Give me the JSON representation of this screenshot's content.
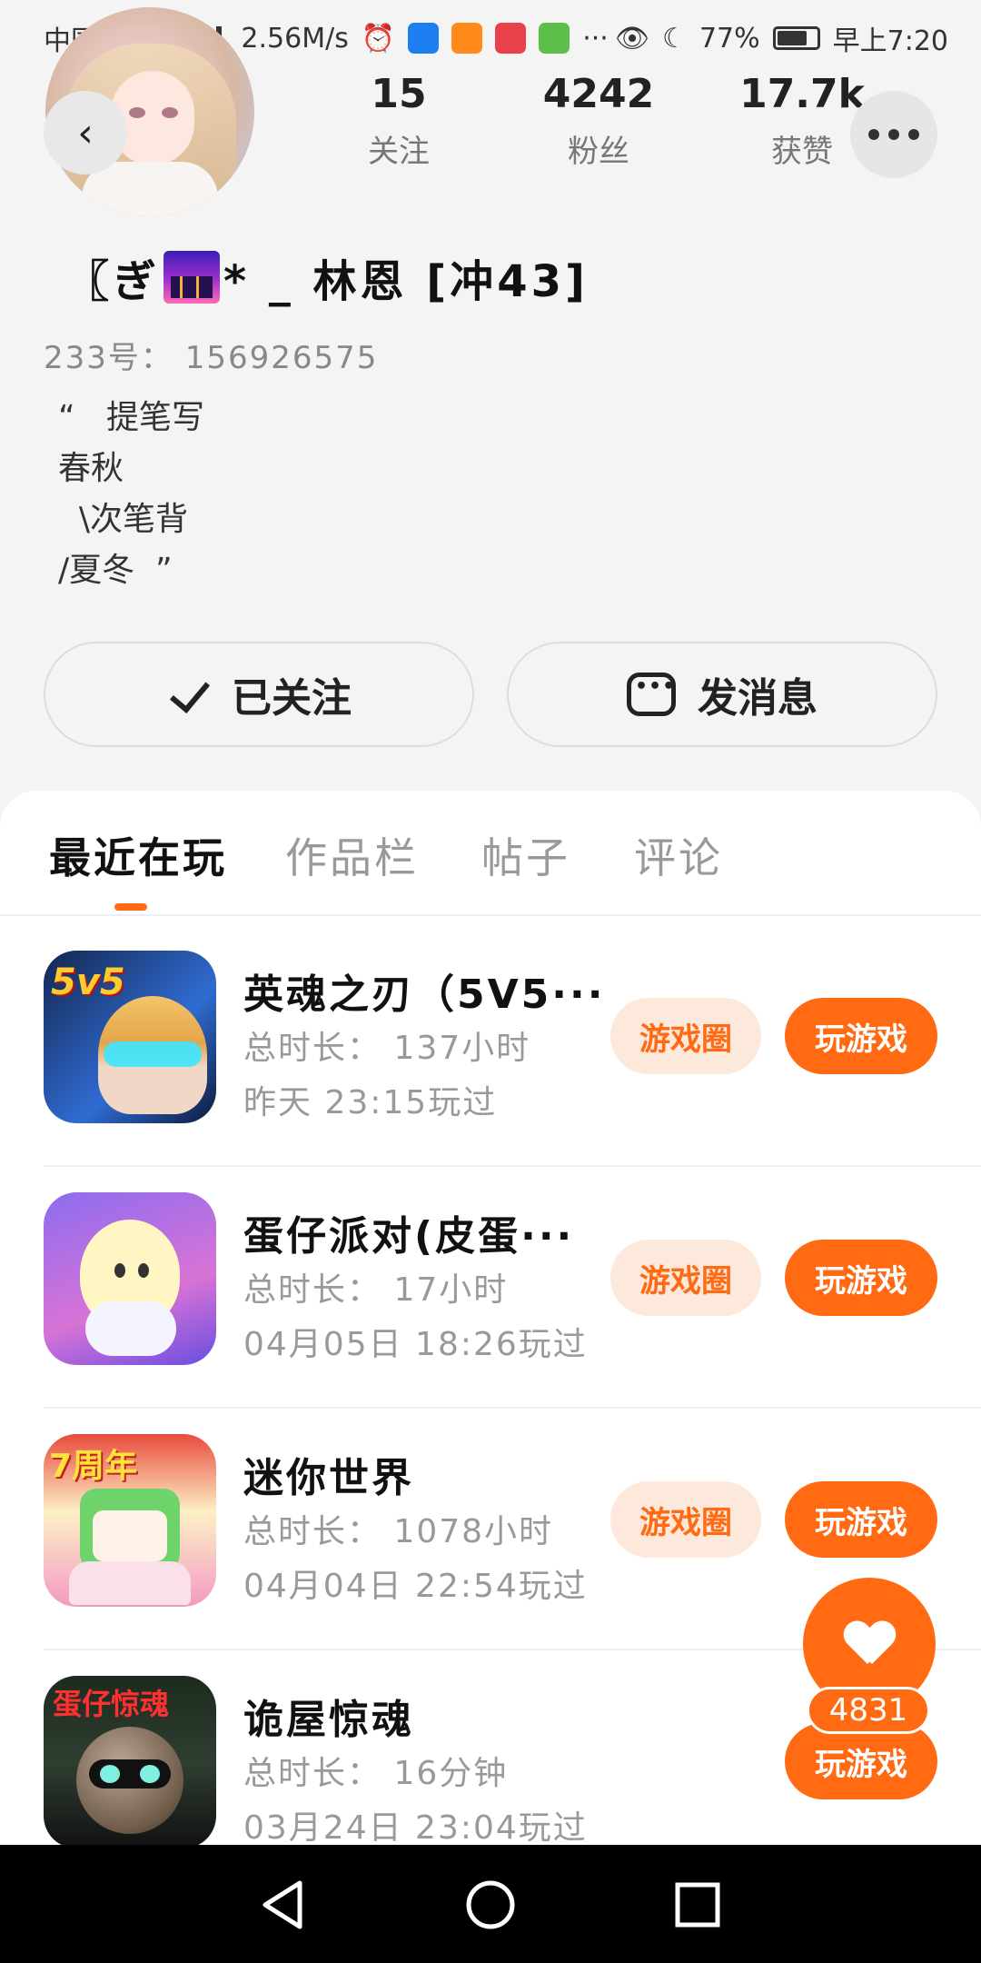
{
  "status_bar": {
    "carrier": "中国电信",
    "network": "4G",
    "speed": "2.56M/s",
    "more": "···",
    "battery": "77%",
    "time": "早上7:20"
  },
  "profile": {
    "back_icon": "back-arrow",
    "more_icon": "more-horizontal",
    "stats": [
      {
        "num": "15",
        "label": "关注"
      },
      {
        "num": "4242",
        "label": "粉丝"
      },
      {
        "num": "17.7k",
        "label": "获赞"
      }
    ],
    "name_prefix": "〖ぎ",
    "name_suffix": "* _ 林恩 [冲43]",
    "uid": "233号： 156926575",
    "bio": "“   提笔写\n春秋\n  \\次笔背\n/夏冬  ”",
    "followed_label": "已关注",
    "message_label": "发消息"
  },
  "tabs": {
    "items": [
      "最近在玩",
      "作品栏",
      "帖子",
      "评论"
    ],
    "active": "最近在玩"
  },
  "games": [
    {
      "name": "英魂之刃（5V5···",
      "duration": "总时长： 137小时",
      "last_played": "昨天 23:15玩过",
      "circle_label": "游戏圈",
      "play_label": "玩游戏",
      "icon_text": "5v5"
    },
    {
      "name": "蛋仔派对(皮蛋···",
      "duration": "总时长： 17小时",
      "last_played": "04月05日 18:26玩过",
      "circle_label": "游戏圈",
      "play_label": "玩游戏",
      "icon_text": ""
    },
    {
      "name": "迷你世界",
      "duration": "总时长： 1078小时",
      "last_played": "04月04日 22:54玩过",
      "circle_label": "游戏圈",
      "play_label": "玩游戏",
      "icon_text": "7周年"
    },
    {
      "name": "诡屋惊魂",
      "duration": "总时长： 16分钟",
      "last_played": "03月24日 23:04玩过",
      "circle_label": "",
      "play_label": "玩游戏",
      "icon_text": "蛋仔惊魂"
    }
  ],
  "like_fab": {
    "count": "4831",
    "icon": "heart"
  },
  "colors": {
    "accent": "#ff6a13",
    "accent_light": "#fde8dc",
    "background": "#f4f4f4"
  }
}
